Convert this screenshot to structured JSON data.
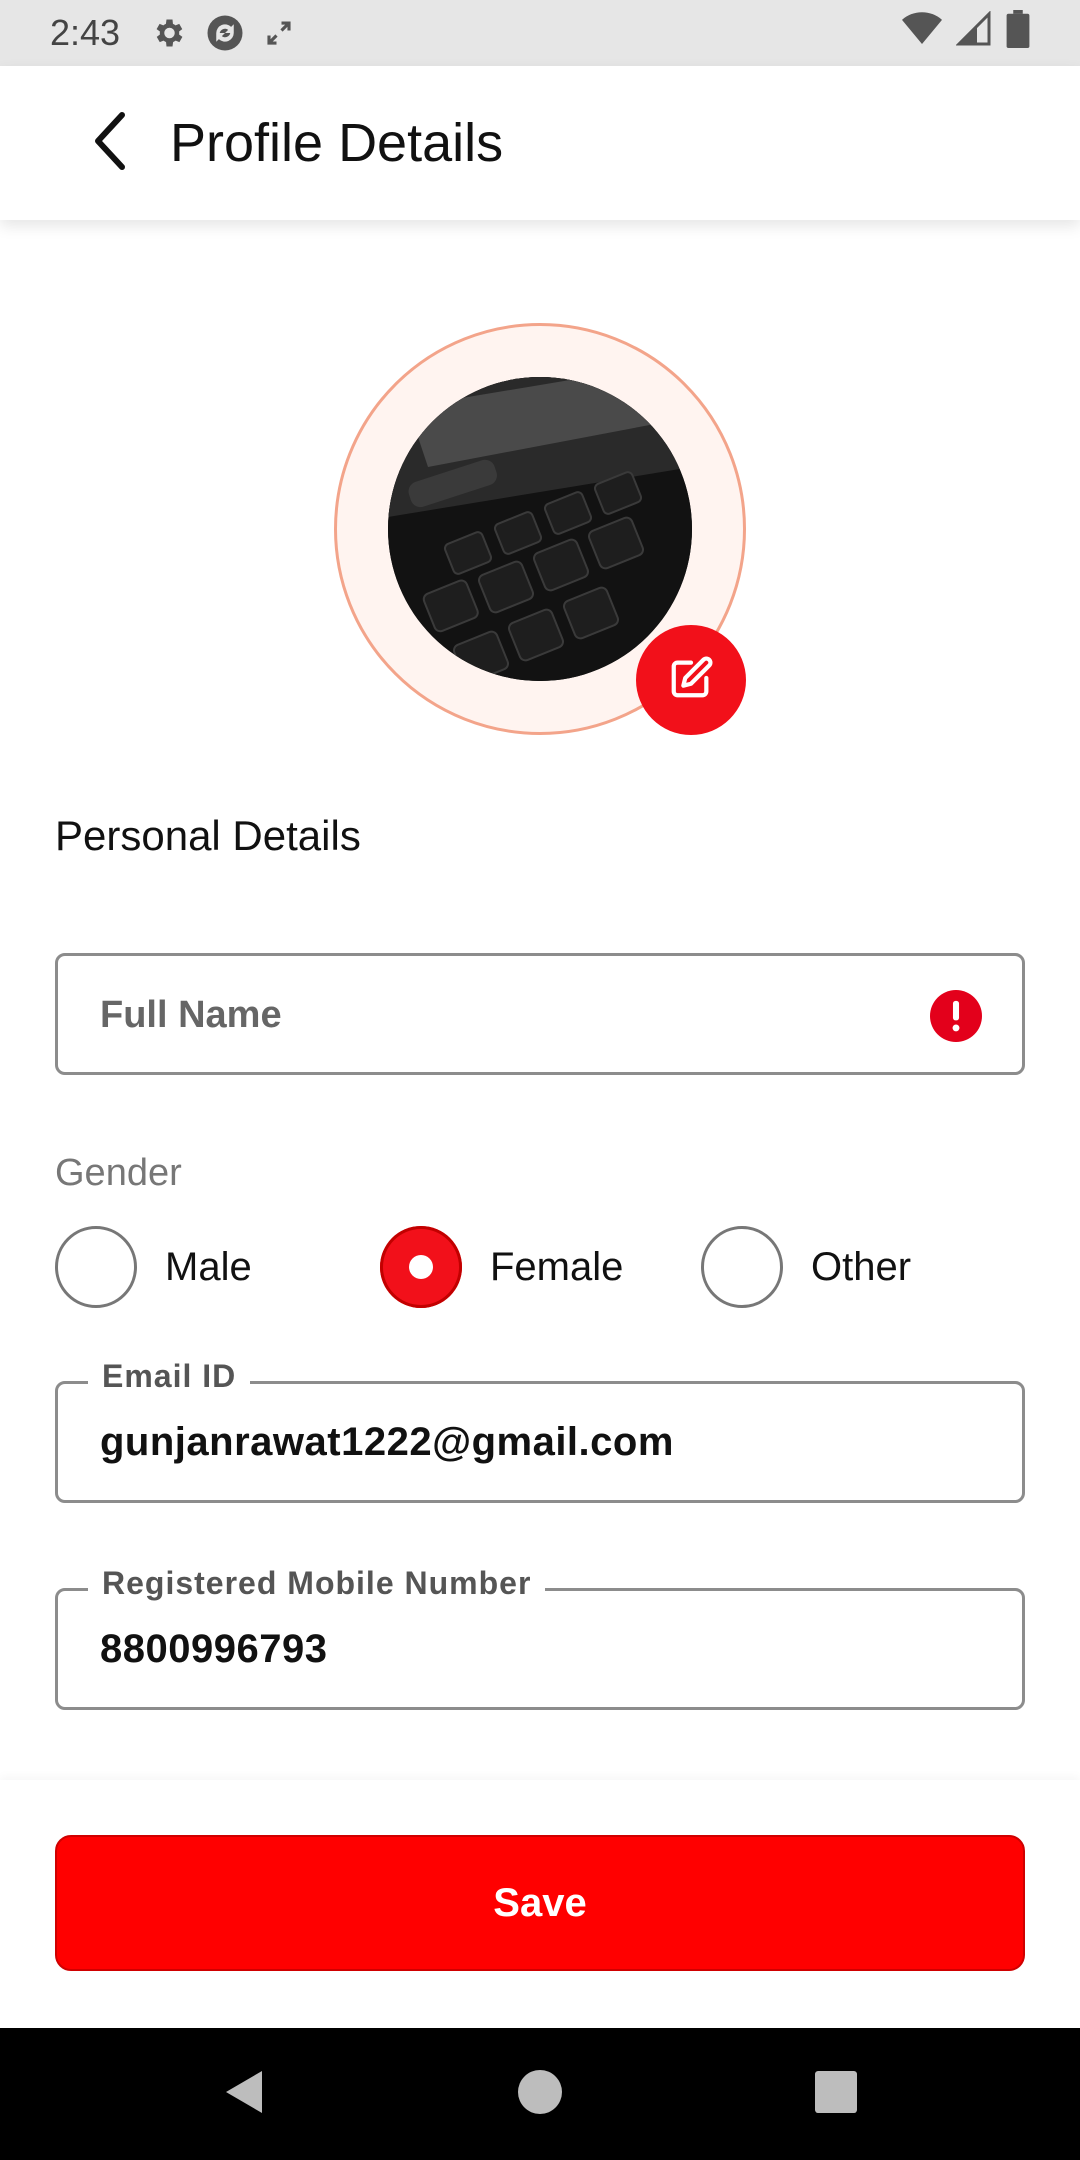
{
  "status_bar": {
    "time": "2:43",
    "left_icons": [
      "settings-icon",
      "sync-icon",
      "screen-rotate-icon"
    ],
    "right_icons": [
      "wifi-icon",
      "cell-signal-icon",
      "battery-icon"
    ]
  },
  "app_bar": {
    "title": "Profile Details",
    "back_icon": "arrow-back-icon"
  },
  "profile": {
    "edit_icon": "edit-icon"
  },
  "section": {
    "personal_details": "Personal Details"
  },
  "form": {
    "full_name": {
      "placeholder": "Full Name",
      "value": "",
      "has_error": true
    },
    "gender": {
      "label": "Gender",
      "options": [
        "Male",
        "Female",
        "Other"
      ],
      "selected": "Female"
    },
    "email": {
      "label": "Email ID",
      "value": "gunjanrawat1222@gmail.com"
    },
    "mobile": {
      "label": "Registered Mobile Number",
      "value": "8800996793"
    }
  },
  "actions": {
    "save_label": "Save"
  },
  "colors": {
    "accent": "#ff0000",
    "error": "#e3001b",
    "avatar_ring": "#f3a48a"
  }
}
